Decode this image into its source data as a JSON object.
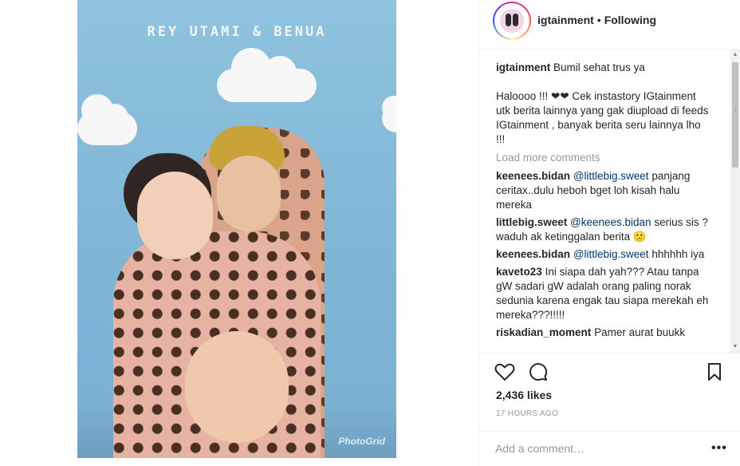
{
  "photo": {
    "title": "REY UTAMI & BENUA",
    "watermark": "PhotoGrid"
  },
  "header": {
    "username": "igtainment",
    "separator": "•",
    "follow_status": "Following"
  },
  "caption": {
    "username": "igtainment",
    "text": "Bumil sehat trus ya",
    "body": "Haloooo !!! ❤❤ Cek instastory IGtainment utk berita lainnya yang gak diupload di feeds IGtainment , banyak berita seru lainnya lho !!!"
  },
  "load_more_label": "Load more comments",
  "comments": [
    {
      "username": "keenees.bidan",
      "mention": "@littlebig.sweet",
      "text": " panjang ceritax..dulu heboh bget loh kisah halu mereka"
    },
    {
      "username": "littlebig.sweet",
      "mention": "@keenees.bidan",
      "text": " serius sis ? waduh ak ketinggalan berita 🙁"
    },
    {
      "username": "keenees.bidan",
      "mention": "@littlebig.sweet",
      "text": " hhhhhh iya"
    },
    {
      "username": "kaveto23",
      "mention": "",
      "text": "Ini siapa dah yah??? Atau tanpa gW sadari gW adalah orang paling norak sedunia karena engak tau siapa merekah eh mereka???!!!!!"
    },
    {
      "username": "riskadian_moment",
      "mention": "",
      "text": "Pamer aurat buukk"
    }
  ],
  "icons": {
    "like": "heart-icon",
    "comment": "comment-icon",
    "save": "bookmark-icon",
    "more": "more-options-icon"
  },
  "likes_label": "2,436 likes",
  "time_label": "17 HOURS AGO",
  "add_comment": {
    "placeholder": "Add a comment…",
    "more": "•••"
  },
  "colors": {
    "text": "#262626",
    "muted": "#999999",
    "mention": "#003569",
    "border": "#efefef"
  }
}
